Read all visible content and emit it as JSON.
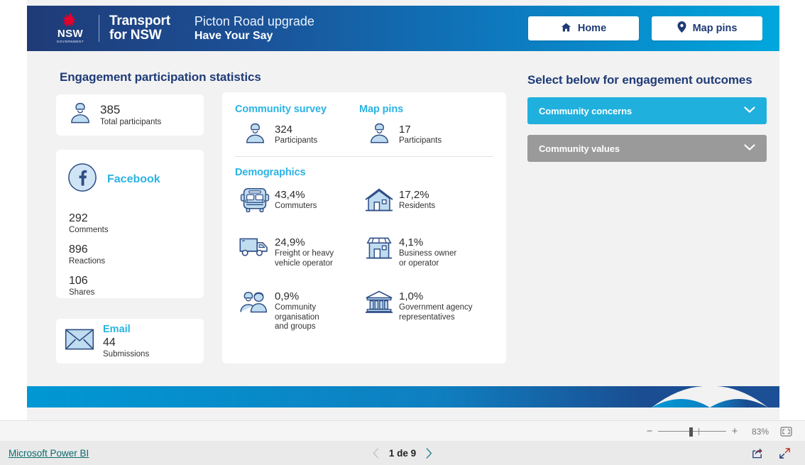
{
  "header": {
    "logo": {
      "icon": "nsw-waratah-logo",
      "nsw": "NSW",
      "government": "GOVERNMENT",
      "agency_line1": "Transport",
      "agency_line2": "for NSW"
    },
    "project_title": "Picton Road upgrade",
    "project_subtitle": "Have Your Say",
    "buttons": [
      {
        "label": "Home",
        "icon": "home-icon"
      },
      {
        "label": "Map pins",
        "icon": "map-pin-icon"
      }
    ]
  },
  "stats": {
    "title": "Engagement participation statistics",
    "total": {
      "icon": "person-icon",
      "value": "385",
      "label": "Total participants"
    },
    "facebook": {
      "icon": "facebook-icon",
      "name": "Facebook",
      "items": [
        {
          "value": "292",
          "label": "Comments"
        },
        {
          "value": "896",
          "label": "Reactions"
        },
        {
          "value": "106",
          "label": "Shares"
        }
      ]
    },
    "email": {
      "icon": "envelope-icon",
      "name": "Email",
      "value": "44",
      "label": "Submissions"
    }
  },
  "channels": [
    {
      "heading": "Community survey",
      "icon": "person-icon",
      "value": "324",
      "label": "Participants"
    },
    {
      "heading": "Map pins",
      "icon": "person-icon",
      "value": "17",
      "label": "Participants"
    }
  ],
  "demographics": {
    "heading": "Demographics",
    "items": [
      {
        "icon": "bus-icon",
        "value": "43,4%",
        "label": "Commuters"
      },
      {
        "icon": "house-icon",
        "value": "17,2%",
        "label": "Residents"
      },
      {
        "icon": "truck-icon",
        "value": "24,9%",
        "label": "Freight or heavy\nvehicle operator"
      },
      {
        "icon": "shop-icon",
        "value": "4,1%",
        "label": "Business owner\nor operator"
      },
      {
        "icon": "people-icon",
        "value": "0,9%",
        "label": "Community\norganisation\nand groups"
      },
      {
        "icon": "government-icon",
        "value": "1,0%",
        "label": "Government agency\nrepresentatives"
      }
    ]
  },
  "outcomes": {
    "title": "Select below for engagement outcomes",
    "accordions": [
      {
        "label": "Community concerns",
        "color": "#20b0de",
        "icon": "chevron-down-icon"
      },
      {
        "label": "Community values",
        "color": "#9a9a9a",
        "icon": "chevron-down-icon"
      }
    ]
  },
  "powerbi": {
    "zoom": {
      "minus": "−",
      "plus": "+",
      "percent": "83%",
      "fit_icon": "fit-to-page-icon"
    },
    "footer_link": "Microsoft Power BI",
    "pager": {
      "prev_icon": "chevron-left-icon",
      "text": "1 de 9",
      "next_icon": "chevron-right-icon"
    },
    "actions": [
      {
        "icon": "share-icon"
      },
      {
        "icon": "fullscreen-icon"
      }
    ]
  },
  "colors": {
    "nsw_navy": "#1f3b77",
    "nsw_blue": "#00a7dd",
    "accent_cyan": "#2bb3e3",
    "icon_fill": "#bfdcf0",
    "icon_stroke": "#2e4e86",
    "canvas": "#f2f2f2"
  }
}
